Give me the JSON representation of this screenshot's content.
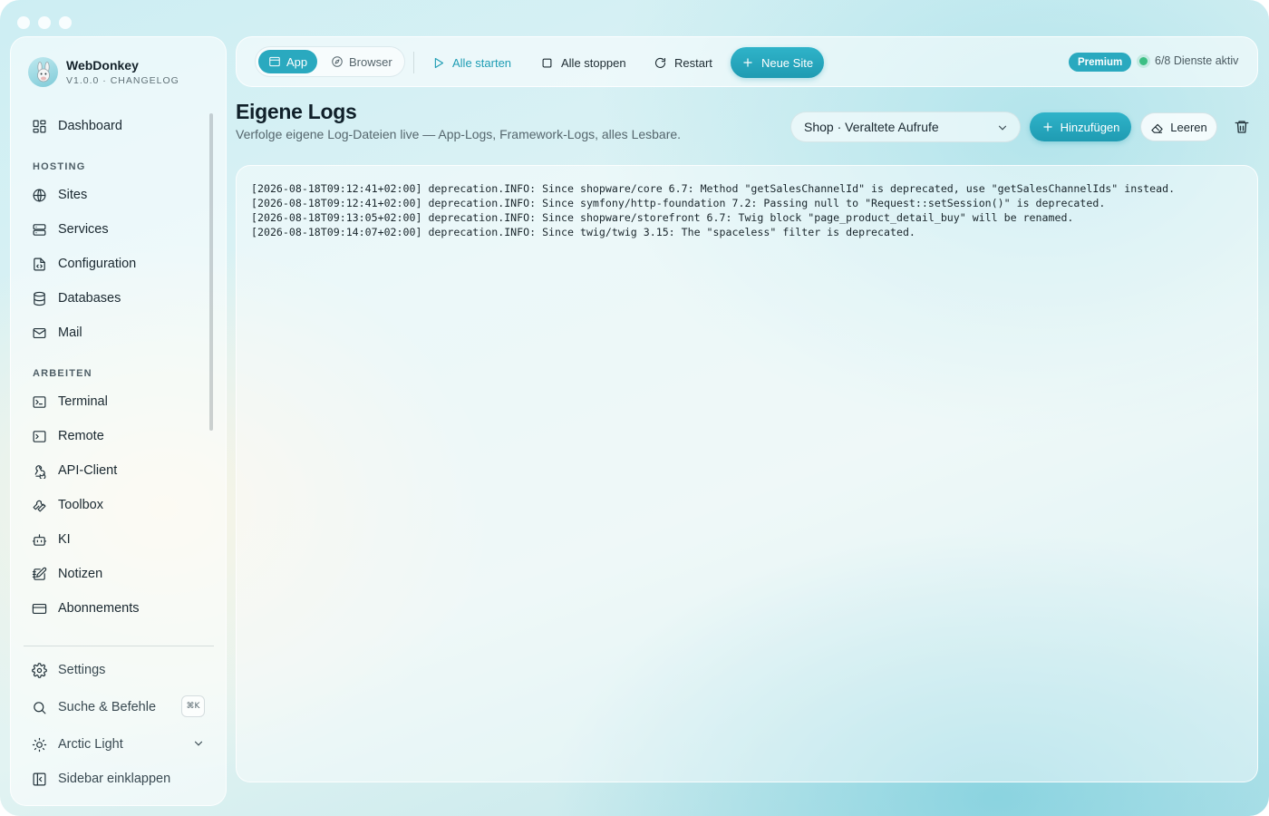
{
  "app": {
    "name": "WebDonkey",
    "version_line": "V1.0.0 · CHANGELOG"
  },
  "sidebar": {
    "dashboard": "Dashboard",
    "section_hosting": "HOSTING",
    "hosting_items": [
      "Sites",
      "Services",
      "Configuration",
      "Databases",
      "Mail"
    ],
    "section_work": "ARBEITEN",
    "work_items": [
      "Terminal",
      "Remote",
      "API-Client",
      "Toolbox",
      "KI",
      "Notizen",
      "Abonnements"
    ],
    "settings": "Settings",
    "search": "Suche & Befehle",
    "search_shortcut": "⌘K",
    "theme": "Arctic Light",
    "collapse": "Sidebar einklappen"
  },
  "toolbar": {
    "view_app": "App",
    "view_browser": "Browser",
    "start_all": "Alle starten",
    "stop_all": "Alle stoppen",
    "restart": "Restart",
    "new_site": "Neue Site",
    "badge": "Premium",
    "services_status": "6/8 Dienste aktiv"
  },
  "header": {
    "title": "Eigene Logs",
    "subtitle": "Verfolge eigene Log-Dateien live — App-Logs, Framework-Logs, alles Lesbare.",
    "selected_log": "Shop · Veraltete Aufrufe",
    "add_label": "Hinzufügen",
    "clear_label": "Leeren"
  },
  "logs": [
    "[2026-08-18T09:12:41+02:00] deprecation.INFO: Since shopware/core 6.7: Method \"getSalesChannelId\" is deprecated, use \"getSalesChannelIds\" instead.",
    "[2026-08-18T09:12:41+02:00] deprecation.INFO: Since symfony/http-foundation 7.2: Passing null to \"Request::setSession()\" is deprecated.",
    "[2026-08-18T09:13:05+02:00] deprecation.INFO: Since shopware/storefront 6.7: Twig block \"page_product_detail_buy\" will be renamed.",
    "[2026-08-18T09:14:07+02:00] deprecation.INFO: Since twig/twig 3.15: The \"spaceless\" filter is deprecated."
  ],
  "colors": {
    "accent": "#2aa9bf",
    "status_ok": "#3cbf84"
  }
}
